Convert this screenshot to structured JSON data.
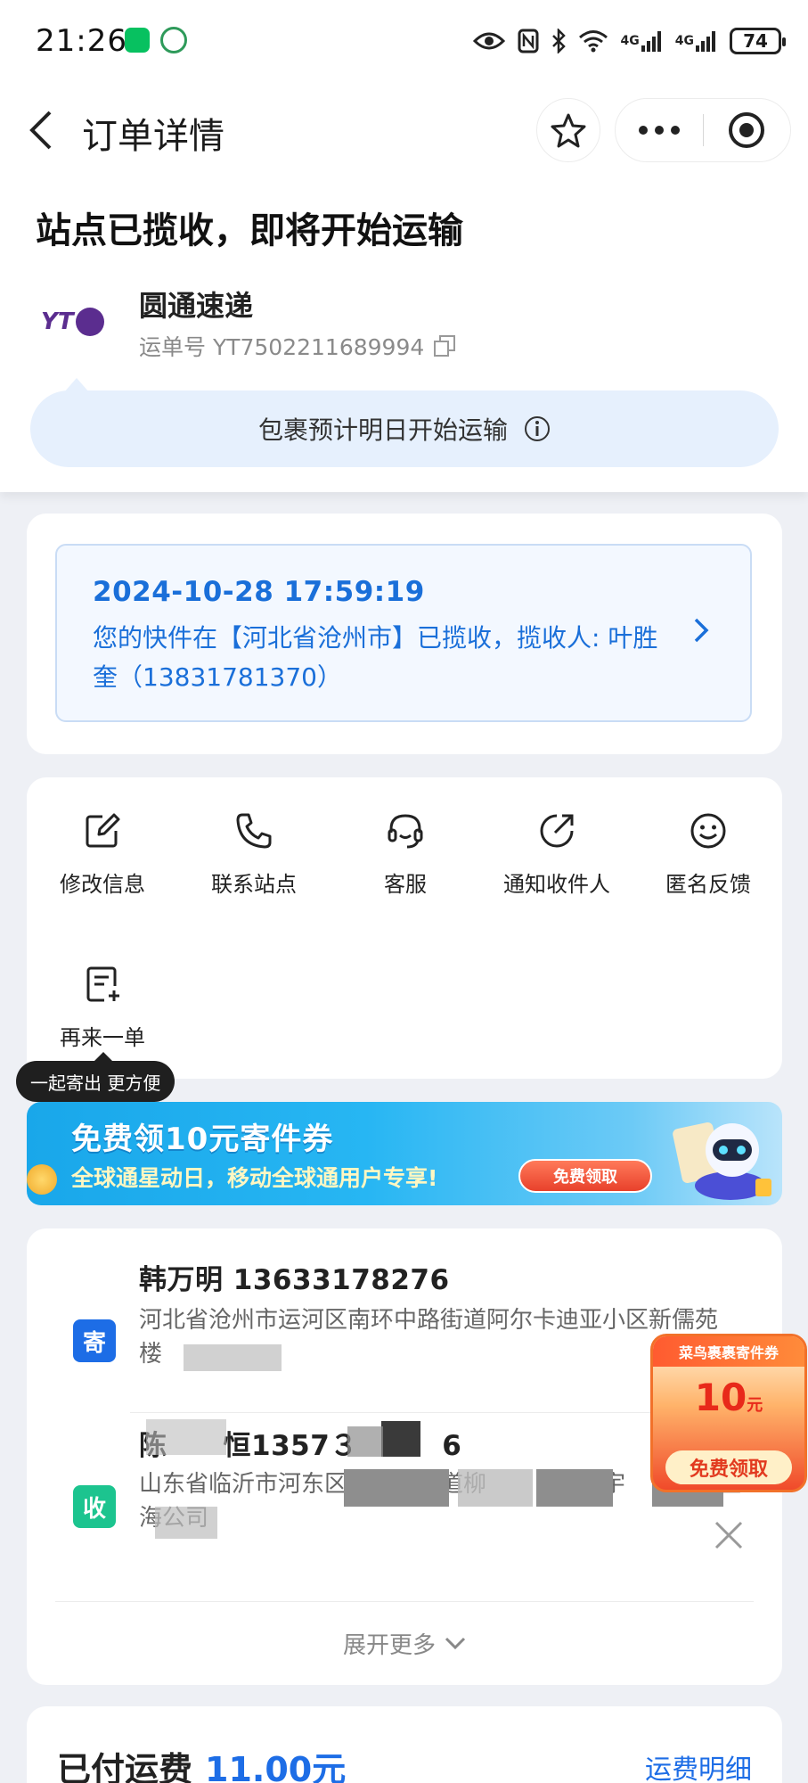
{
  "status_bar": {
    "time": "21:26",
    "battery": "74",
    "network_1": "4G",
    "network_2": "4G"
  },
  "header": {
    "title": "订单详情"
  },
  "order_status": {
    "heading": "站点已揽收，即将开始运输",
    "courier_name": "圆通速递",
    "courier_logo_text": "YT",
    "waybill": "运单号 YT7502211689994",
    "notice": "包裹预计明日开始运输"
  },
  "tracking": {
    "time": "2024-10-28 17:59:19",
    "text": "您的快件在【河北省沧州市】已揽收，揽收人: 叶胜奎（13831781370）"
  },
  "actions": [
    {
      "label": "修改信息",
      "icon": "edit-icon"
    },
    {
      "label": "联系站点",
      "icon": "phone-icon"
    },
    {
      "label": "客服",
      "icon": "headset-icon"
    },
    {
      "label": "通知收件人",
      "icon": "share-icon"
    },
    {
      "label": "匿名反馈",
      "icon": "smile-icon"
    },
    {
      "label": "再来一单",
      "icon": "reorder-icon"
    }
  ],
  "action_tooltip": "一起寄出 更方便",
  "banner": {
    "title": "免费领10元寄件券",
    "subtitle": "全球通星动日，移动全球通用户专享!",
    "button": "免费领取"
  },
  "sender": {
    "tag": "寄",
    "name": "韩万明 13633178276",
    "address": "河北省沧州市运河区南环中路街道阿尔卡迪亚小区新儒苑　　楼"
  },
  "receiver": {
    "tag": "收",
    "name": "陈　　恒1357３　　　6",
    "address": "山东省临沂市河东区　　　　道柳　　　　翔宇　　　　直海公司"
  },
  "expand_more": "展开更多",
  "float_coupon": {
    "header": "菜鸟裹裹寄件券",
    "value": "10",
    "unit": "元",
    "button": "免费领取"
  },
  "fee": {
    "label": "已付运费",
    "amount": "11.00元",
    "detail_link": "运费明细"
  },
  "colors": {
    "accent_blue": "#1d6de6",
    "tracking_blue": "#1a6fd9",
    "receiver_green": "#1cc48f",
    "notice_bg": "#e6f0fd"
  }
}
